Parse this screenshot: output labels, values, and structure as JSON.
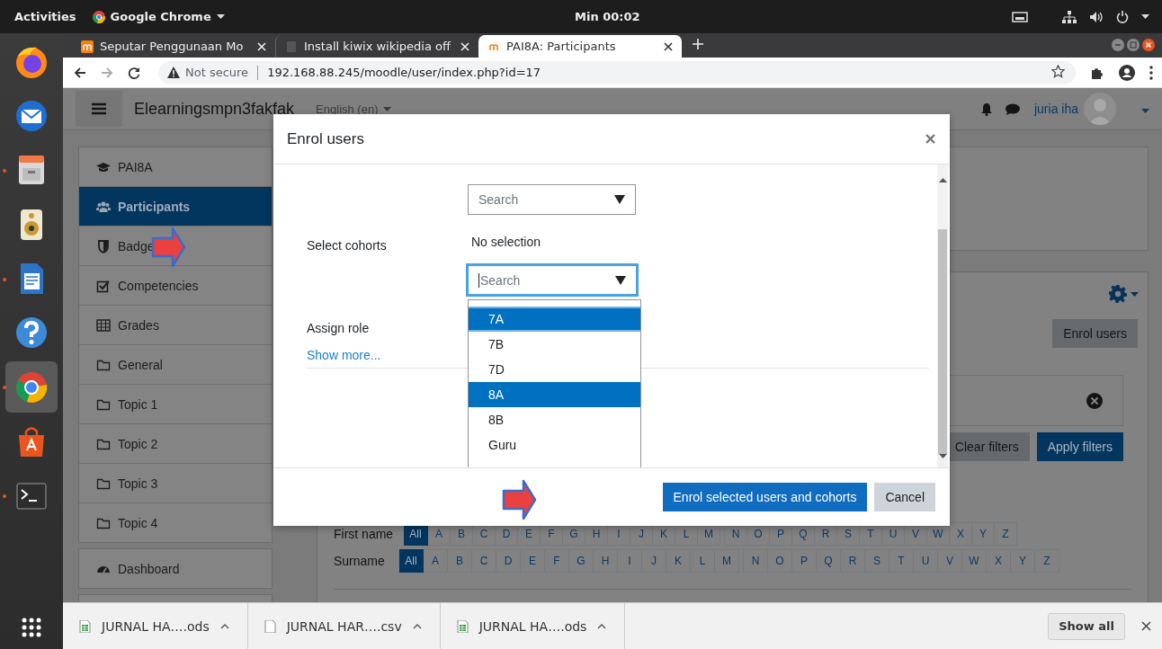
{
  "top_bar": {
    "activities": "Activities",
    "app_menu": "Google Chrome",
    "clock": "Min 00:02"
  },
  "dock": {
    "apps": [
      {
        "kind": "firefox",
        "running": false,
        "selected": false
      },
      {
        "kind": "mail",
        "running": false,
        "selected": false
      },
      {
        "kind": "files",
        "running": true,
        "selected": false
      },
      {
        "kind": "music",
        "running": false,
        "selected": false
      },
      {
        "kind": "writer",
        "running": true,
        "selected": false
      },
      {
        "kind": "help",
        "running": false,
        "selected": false
      },
      {
        "kind": "chrome",
        "running": true,
        "selected": true
      },
      {
        "kind": "store",
        "running": false,
        "selected": false
      },
      {
        "kind": "terminal",
        "running": true,
        "selected": false
      }
    ]
  },
  "browser": {
    "tabs": [
      {
        "title": "Seputar Penggunaan Mo",
        "selected": false
      },
      {
        "title": "Install kiwix wikipedia off",
        "selected": false
      },
      {
        "title": "PAI8A: Participants",
        "selected": true
      }
    ],
    "security": "Not secure",
    "url": "192.168.88.245/moodle/user/index.php?id=17"
  },
  "moodle": {
    "site_name": "Elearningsmpn3fakfak",
    "language": "English (en)",
    "user": "juria iha",
    "nav": [
      {
        "label": "PAI8A",
        "kind": "course",
        "selected": false
      },
      {
        "label": "Participants",
        "kind": "users",
        "selected": true
      },
      {
        "label": "Badge",
        "kind": "shield",
        "selected": false
      },
      {
        "label": "Competencies",
        "kind": "check",
        "selected": false
      },
      {
        "label": "Grades",
        "kind": "table",
        "selected": false
      },
      {
        "label": "General",
        "kind": "folder",
        "selected": false
      },
      {
        "label": "Topic 1",
        "kind": "folder",
        "selected": false
      },
      {
        "label": "Topic 2",
        "kind": "folder",
        "selected": false
      },
      {
        "label": "Topic 3",
        "kind": "folder",
        "selected": false
      },
      {
        "label": "Topic 4",
        "kind": "folder",
        "selected": false
      }
    ],
    "dashboard": {
      "label": "Dashboard",
      "kind": "dashboard",
      "selected": false
    },
    "enrol_button": "Enrol users",
    "clear_filters": "Clear filters",
    "apply_filters": "Apply filters",
    "initials": [
      {
        "label": "First name",
        "letters": [
          {
            "label": "All",
            "selected": true
          },
          {
            "label": "A",
            "selected": false
          },
          {
            "label": "B",
            "selected": false
          },
          {
            "label": "C",
            "selected": false
          },
          {
            "label": "D",
            "selected": false
          },
          {
            "label": "E",
            "selected": false
          },
          {
            "label": "F",
            "selected": false
          },
          {
            "label": "G",
            "selected": false
          },
          {
            "label": "H",
            "selected": false
          },
          {
            "label": "I",
            "selected": false
          },
          {
            "label": "J",
            "selected": false
          },
          {
            "label": "K",
            "selected": false
          },
          {
            "label": "L",
            "selected": false
          },
          {
            "label": "M",
            "selected": false
          },
          {
            "label": "N",
            "selected": false
          },
          {
            "label": "O",
            "selected": false
          },
          {
            "label": "P",
            "selected": false
          },
          {
            "label": "Q",
            "selected": false
          },
          {
            "label": "R",
            "selected": false
          },
          {
            "label": "S",
            "selected": false
          },
          {
            "label": "T",
            "selected": false
          },
          {
            "label": "U",
            "selected": false
          },
          {
            "label": "V",
            "selected": false
          },
          {
            "label": "W",
            "selected": false
          },
          {
            "label": "X",
            "selected": false
          },
          {
            "label": "Y",
            "selected": false
          },
          {
            "label": "Z",
            "selected": false
          }
        ]
      },
      {
        "label": "Surname",
        "letters": [
          {
            "label": "All",
            "selected": true
          },
          {
            "label": "A",
            "selected": false
          },
          {
            "label": "B",
            "selected": false
          },
          {
            "label": "C",
            "selected": false
          },
          {
            "label": "D",
            "selected": false
          },
          {
            "label": "E",
            "selected": false
          },
          {
            "label": "F",
            "selected": false
          },
          {
            "label": "G",
            "selected": false
          },
          {
            "label": "H",
            "selected": false
          },
          {
            "label": "I",
            "selected": false
          },
          {
            "label": "J",
            "selected": false
          },
          {
            "label": "K",
            "selected": false
          },
          {
            "label": "L",
            "selected": false
          },
          {
            "label": "M",
            "selected": false
          },
          {
            "label": "N",
            "selected": false
          },
          {
            "label": "O",
            "selected": false
          },
          {
            "label": "P",
            "selected": false
          },
          {
            "label": "Q",
            "selected": false
          },
          {
            "label": "R",
            "selected": false
          },
          {
            "label": "S",
            "selected": false
          },
          {
            "label": "T",
            "selected": false
          },
          {
            "label": "U",
            "selected": false
          },
          {
            "label": "V",
            "selected": false
          },
          {
            "label": "W",
            "selected": false
          },
          {
            "label": "X",
            "selected": false
          },
          {
            "label": "Y",
            "selected": false
          },
          {
            "label": "Z",
            "selected": false
          }
        ]
      }
    ]
  },
  "dialog": {
    "title": "Enrol users",
    "users_search": {
      "placeholder": "Search"
    },
    "cohorts_label": "Select cohorts",
    "cohorts_selection": "No selection",
    "cohorts_search": {
      "placeholder": "Search",
      "focused": true
    },
    "cohort_options": [
      {
        "label": "7A",
        "selected": true
      },
      {
        "label": "7B",
        "selected": false
      },
      {
        "label": "7D",
        "selected": false
      },
      {
        "label": "8A",
        "selected": true
      },
      {
        "label": "8B",
        "selected": false
      },
      {
        "label": "Guru",
        "selected": false
      }
    ],
    "role_label": "Assign role",
    "show_more": "Show more...",
    "buttons": [
      {
        "label": "Enrol selected users and cohorts",
        "kind": "primary"
      },
      {
        "label": "Cancel",
        "kind": "secondary"
      }
    ]
  },
  "downloads": {
    "files": [
      {
        "name": "JURNAL HA….ods",
        "kind": "sheet"
      },
      {
        "name": "JURNAL HAR….csv",
        "kind": "file"
      },
      {
        "name": "JURNAL HA….ods",
        "kind": "sheet"
      }
    ],
    "show_all": "Show all"
  }
}
